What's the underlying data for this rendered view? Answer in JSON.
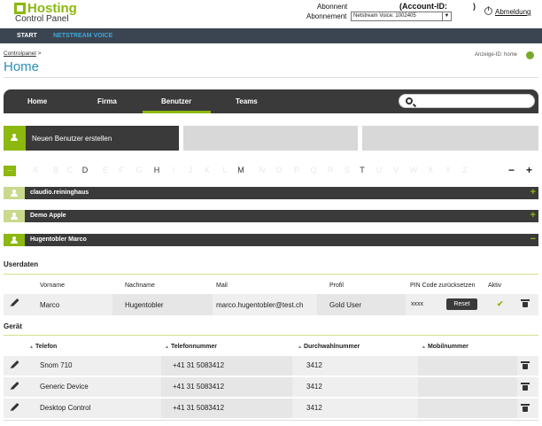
{
  "header": {
    "logo_text": "Hosting",
    "logo_sub": "Control Panel",
    "abonnent_label": "Abonnent",
    "account_label": "(Account-ID:",
    "account_close": ")",
    "abonnement_label": "Abonnement",
    "abonnement_value": "Netstream Voice: 1002405",
    "logout_label": "Abmeldung"
  },
  "navbar": {
    "start": "START",
    "voice": "NETSTREAM VOICE"
  },
  "breadcrumb": {
    "root": "Controlpanel",
    "sep": ">"
  },
  "page_title": "Home",
  "anzeige": "Anzeige-ID:  home",
  "tabs": [
    {
      "label": "Home"
    },
    {
      "label": "Firma"
    },
    {
      "label": "Benutzer"
    },
    {
      "label": "Teams"
    }
  ],
  "search": {
    "placeholder": ""
  },
  "actions": {
    "new_user": "Neuen Benutzer erstellen"
  },
  "letters": {
    "all": "...",
    "items": [
      "A",
      "B",
      "C",
      "D",
      "E",
      "F",
      "G",
      "H",
      "I",
      "J",
      "K",
      "L",
      "M",
      "N",
      "O",
      "P",
      "Q",
      "R",
      "S",
      "T",
      "U",
      "V",
      "W",
      "X",
      "Y",
      "Z"
    ],
    "active": [
      "D",
      "H",
      "M",
      "T"
    ],
    "collapse": "−",
    "expand": "+"
  },
  "groups": [
    {
      "name": "claudio.reininghaus",
      "toggle": "+"
    },
    {
      "name": "Demo Apple",
      "toggle": "+"
    },
    {
      "name": "Hugentobler Marco",
      "toggle": "−"
    }
  ],
  "userdaten": {
    "title": "Userdaten",
    "headers": {
      "vorname": "Vorname",
      "nachname": "Nachname",
      "mail": "Mail",
      "profil": "Profil",
      "pin": "PIN Code zurücksetzen",
      "aktiv": "Aktiv"
    },
    "row": {
      "vorname": "Marco",
      "nachname": "Hugentobler",
      "mail": "marco.hugentobler@test.ch",
      "profil": "Gold User",
      "pin": "xxxx",
      "reset": "Reset",
      "aktiv": "✔"
    }
  },
  "geraet": {
    "title": "Gerät",
    "headers": {
      "telefon": "Telefon",
      "telefonnummer": "Telefonnummer",
      "durchwahl": "Durchwahlnummer",
      "mobil": "Mobilnummer"
    },
    "rows": [
      {
        "telefon": "Snom 710",
        "telefonnummer": "+41 31 5083412",
        "durchwahl": "3412",
        "mobil": ""
      },
      {
        "telefon": "Generic Device",
        "telefonnummer": "+41 31 5083412",
        "durchwahl": "3412",
        "mobil": ""
      },
      {
        "telefon": "Desktop Control",
        "telefonnummer": "+41 31 5083412",
        "durchwahl": "3412",
        "mobil": ""
      }
    ]
  },
  "colors": {
    "accent_green": "#8cb80f",
    "dark_bar": "#3a3a3a",
    "title_blue": "#2b8fb8",
    "nav_bg": "#3b4551"
  }
}
